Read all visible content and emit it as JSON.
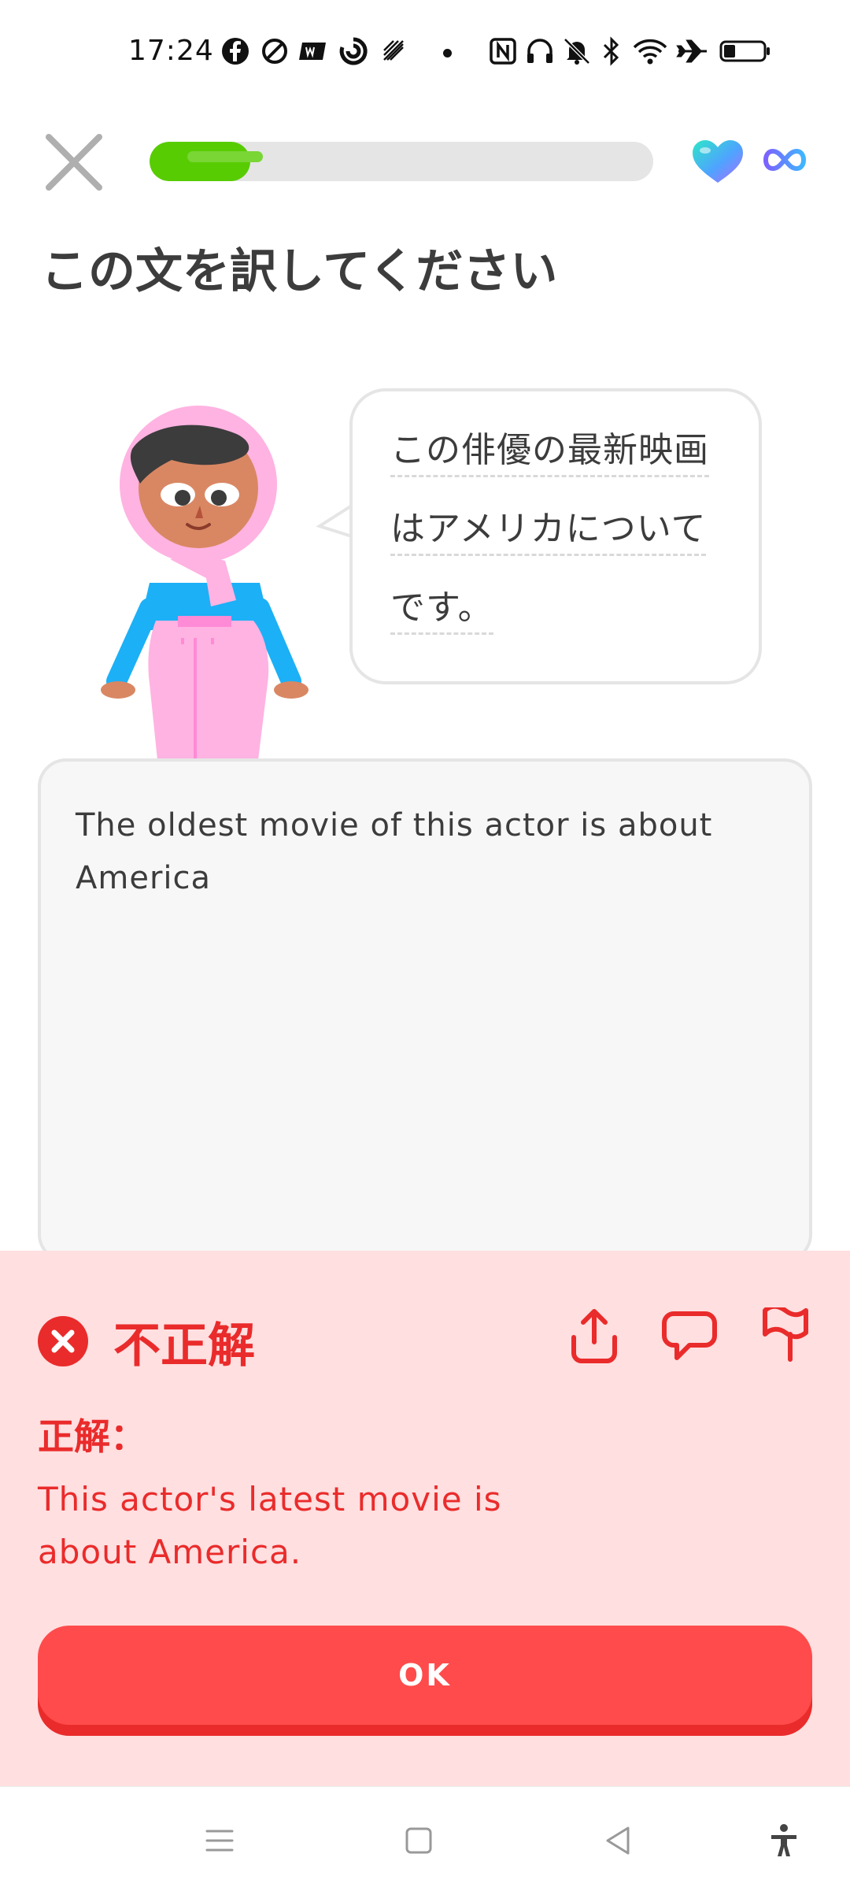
{
  "status_bar": {
    "time": "17:24",
    "notification_icons": [
      "facebook-icon",
      "app-icon",
      "news-icon",
      "sync-icon",
      "app-icon",
      "more-dot-icon"
    ],
    "system_icons": [
      "nfc-icon",
      "headphones-icon",
      "mute-icon",
      "bluetooth-icon",
      "wifi-icon",
      "airplane-icon",
      "battery-icon"
    ]
  },
  "header": {
    "progress_fraction": 0.2,
    "colors": {
      "progress": "#58cc02",
      "heart": "#4fc3f7",
      "infinity": "#7b61ff"
    }
  },
  "exercise": {
    "title": "この文を訳してください",
    "prompt_lines": [
      "この俳優の最新映画",
      "はアメリカについて",
      "です。"
    ]
  },
  "answer": {
    "text": "The oldest movie of this actor is about America"
  },
  "feedback": {
    "heading": "不正解",
    "correct_label": "正解：",
    "correct_answer": "This actor's latest movie is about America.",
    "button_label": "OK",
    "colors": {
      "panel": "#ffdfe0",
      "text": "#ea2b2b",
      "button": "#ff4b4b"
    }
  },
  "nav_bar": {
    "icons": [
      "menu-icon",
      "home-icon",
      "back-icon",
      "accessibility-icon"
    ]
  }
}
